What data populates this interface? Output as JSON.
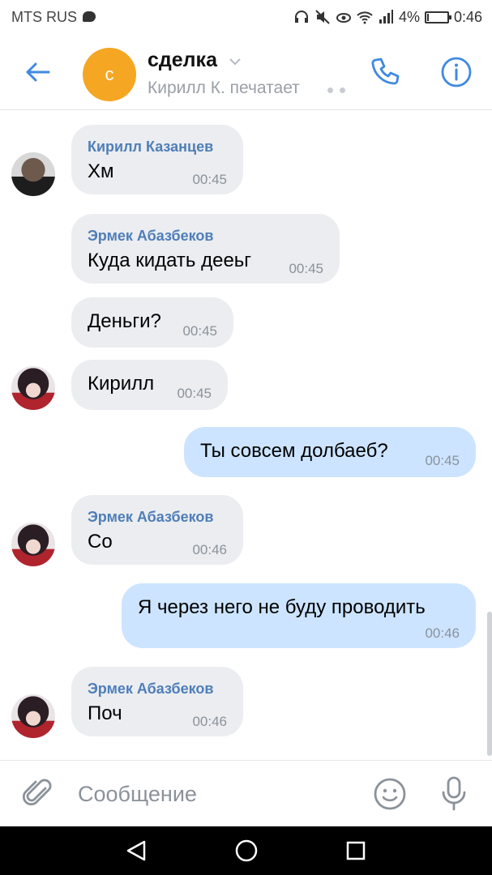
{
  "status_bar": {
    "carrier": "MTS RUS",
    "battery": "4%",
    "time": "0:46"
  },
  "header": {
    "avatar_letter": "с",
    "title": "сделка",
    "subtitle": "Кирилл К. печатает",
    "icons": [
      "back-arrow-icon",
      "chevron-down-icon",
      "phone-icon",
      "info-icon"
    ],
    "accent": "#3f8ae0",
    "avatar_color": "#f5a623"
  },
  "messages": [
    {
      "direction": "in",
      "sender": "Кирилл Казанцев",
      "text": "Хм",
      "time": "00:45",
      "avatar": "boy"
    },
    {
      "direction": "in",
      "sender": "Эрмек Абазбеков",
      "text": "Куда кидать дееьг",
      "time": "00:45",
      "avatar": ""
    },
    {
      "direction": "in",
      "sender": "",
      "text": "Деньги?",
      "time": "00:45",
      "avatar": ""
    },
    {
      "direction": "in",
      "sender": "",
      "text": "Кирилл",
      "time": "00:45",
      "avatar": "anime"
    },
    {
      "direction": "out",
      "sender": "",
      "text": "Ты совсем долбаеб?",
      "time": "00:45",
      "avatar": ""
    },
    {
      "direction": "in",
      "sender": "Эрмек Абазбеков",
      "text": "Со",
      "time": "00:46",
      "avatar": "anime"
    },
    {
      "direction": "out",
      "sender": "",
      "text": "Я через него не буду проводить",
      "time": "00:46",
      "avatar": ""
    },
    {
      "direction": "in",
      "sender": "Эрмек Абазбеков",
      "text": "Поч",
      "time": "00:46",
      "avatar": "anime"
    }
  ],
  "input": {
    "placeholder": "Сообщение",
    "value": ""
  },
  "colors": {
    "incoming_bubble": "#ebedf0",
    "outgoing_bubble": "#cce4ff",
    "sender_name": "#4f7eb8"
  }
}
